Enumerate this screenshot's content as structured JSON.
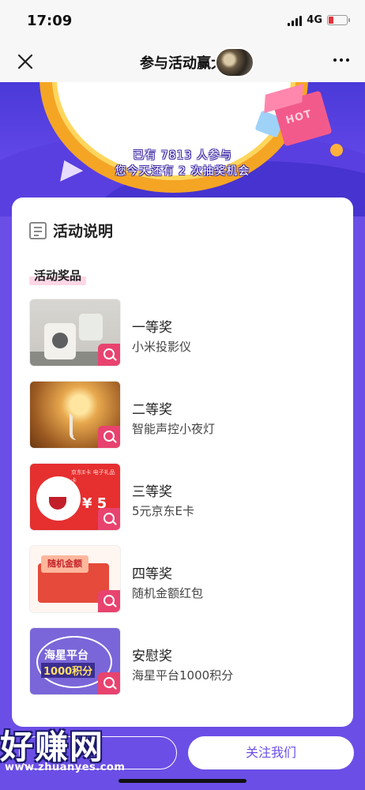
{
  "status_bar": {
    "time": "17:09",
    "network": "4G"
  },
  "nav": {
    "title": "参与活动赢大"
  },
  "banner": {
    "hot": "HOT",
    "line1": "已有 7813 人参与",
    "line2": "您今天还有 2 次抽奖机会"
  },
  "card": {
    "title": "活动说明",
    "section": "活动奖品",
    "prizes": [
      {
        "level": "一等奖",
        "name": "小米投影仪"
      },
      {
        "level": "二等奖",
        "name": "智能声控小夜灯"
      },
      {
        "level": "三等奖",
        "name": "5元京东E卡",
        "thumb_top": "京东E卡 电子礼品卡",
        "thumb_value": "¥ 5"
      },
      {
        "level": "四等奖",
        "name": "随机金额红包",
        "thumb_tag": "随机金额"
      },
      {
        "level": "安慰奖",
        "name": "海星平台1000积分",
        "thumb_line1": "海星平台",
        "thumb_line2": "1000积分"
      }
    ]
  },
  "bottom": {
    "follow_label": "关注我们"
  },
  "watermark": {
    "big": "好赚网",
    "url": "www.zhuanyes.com"
  },
  "colors": {
    "accent": "#6b4ee6",
    "badge": "#e8436f"
  },
  "icons": {
    "close": "close-icon",
    "more": "more-icon",
    "doc": "document-icon",
    "search": "search-icon"
  }
}
